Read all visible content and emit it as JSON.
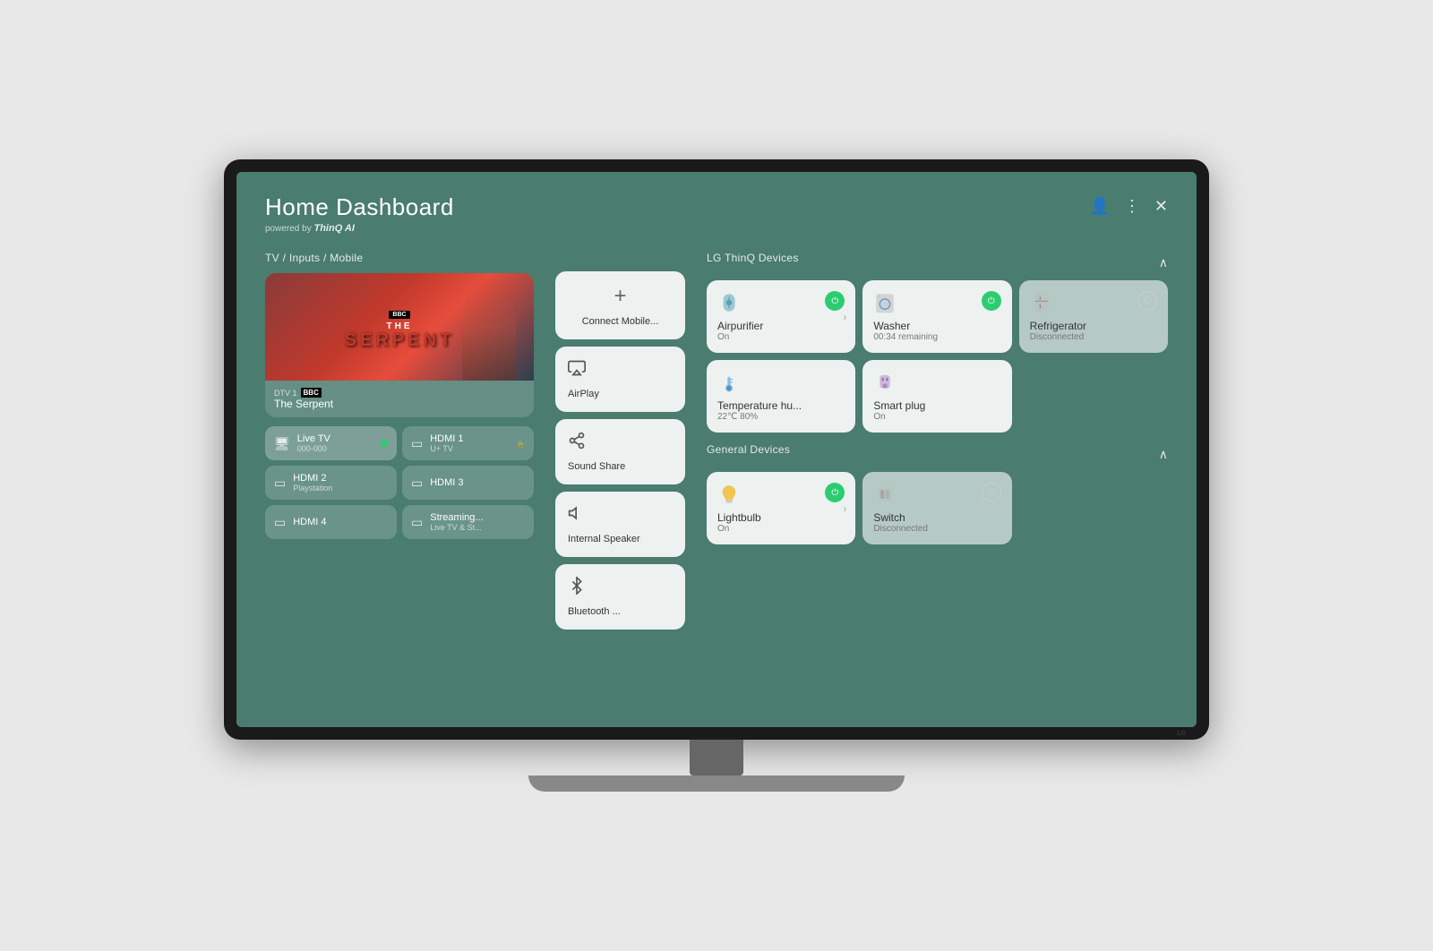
{
  "header": {
    "title": "Home Dashboard",
    "subtitle": "powered by",
    "subtitle_brand": "ThinQ AI",
    "actions": {
      "profile_icon": "👤",
      "menu_icon": "⋮",
      "close_icon": "✕"
    }
  },
  "left_section": {
    "title": "TV / Inputs / Mobile",
    "tv_show": {
      "channel": "DTV 1",
      "show_name": "The Serpent",
      "show_title_line1": "THE",
      "show_title_line2": "SERPENT"
    },
    "inputs": [
      {
        "id": "live-tv",
        "name": "Live TV",
        "sub": "000-000",
        "active": true,
        "icon": "🖥"
      },
      {
        "id": "hdmi1",
        "name": "HDMI 1",
        "sub": "U+ TV",
        "active": false,
        "icon": "▭"
      },
      {
        "id": "hdmi2",
        "name": "HDMI 2",
        "sub": "Playstation",
        "active": false,
        "icon": "▭"
      },
      {
        "id": "hdmi3",
        "name": "HDMI 3",
        "sub": "",
        "active": false,
        "icon": "▭"
      },
      {
        "id": "hdmi4",
        "name": "HDMI 4",
        "sub": "",
        "active": false,
        "icon": "▭"
      },
      {
        "id": "streaming",
        "name": "Streaming...",
        "sub": "Live TV & St...",
        "active": false,
        "icon": "▭"
      }
    ]
  },
  "audio_section": {
    "connect_mobile": {
      "label": "Connect Mobile...",
      "icon": "+"
    },
    "items": [
      {
        "id": "airplay",
        "label": "AirPlay",
        "icon": "airplay"
      },
      {
        "id": "sound-share",
        "label": "Sound Share",
        "icon": "sound-share"
      },
      {
        "id": "internal-speaker",
        "label": "Internal Speaker",
        "icon": "speaker"
      },
      {
        "id": "bluetooth",
        "label": "Bluetooth ...",
        "icon": "bluetooth"
      }
    ]
  },
  "thinq_section": {
    "title": "LG ThinQ Devices",
    "devices": [
      {
        "id": "airpurifier",
        "name": "Airpurifier",
        "status": "On",
        "icon": "💨",
        "power": true,
        "disconnected": false,
        "has_arrow": true
      },
      {
        "id": "washer",
        "name": "Washer",
        "status": "00:34 remaining",
        "icon": "🫧",
        "power": true,
        "disconnected": false,
        "has_arrow": false
      },
      {
        "id": "refrigerator",
        "name": "Refrigerator",
        "status": "Disconnected",
        "icon": "🧊",
        "power": false,
        "disconnected": true,
        "has_arrow": false
      },
      {
        "id": "temperature",
        "name": "Temperature hu...",
        "status": "22℃ 80%",
        "icon": "🌡",
        "power": false,
        "disconnected": false,
        "has_arrow": false
      },
      {
        "id": "smartplug",
        "name": "Smart plug",
        "status": "On",
        "icon": "🔌",
        "power": false,
        "disconnected": false,
        "has_arrow": false
      }
    ]
  },
  "general_section": {
    "title": "General Devices",
    "devices": [
      {
        "id": "lightbulb",
        "name": "Lightbulb",
        "status": "On",
        "icon": "💡",
        "power": true,
        "disconnected": false,
        "has_arrow": true
      },
      {
        "id": "switch",
        "name": "Switch",
        "status": "Disconnected",
        "icon": "🔲",
        "power": false,
        "disconnected": true,
        "has_arrow": false
      }
    ]
  },
  "colors": {
    "bg": "#4a7c6f",
    "card_bg": "rgba(255,255,255,0.9)",
    "card_disconnected": "rgba(255,255,255,0.6)",
    "power_on": "#2ecc71",
    "text_primary": "#ffffff",
    "text_card": "#333333",
    "text_muted": "#777777"
  }
}
